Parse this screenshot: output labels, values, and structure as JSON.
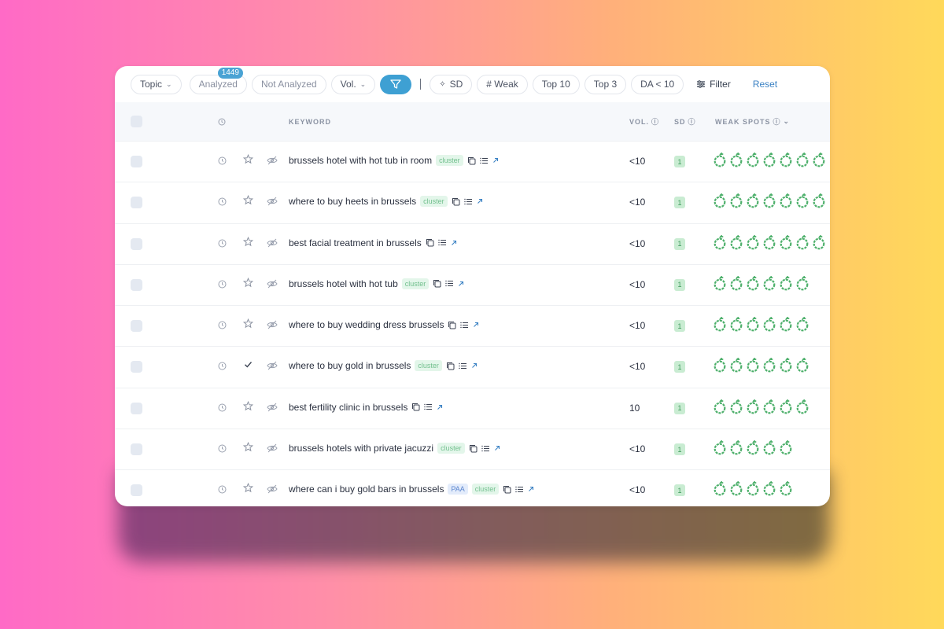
{
  "toolbar": {
    "topic": "Topic",
    "analyzed": "Analyzed",
    "analyzed_count": "1449",
    "not_analyzed": "Not Analyzed",
    "vol": "Vol.",
    "sd": "SD",
    "weak": "# Weak",
    "top10": "Top 10",
    "top3": "Top 3",
    "da": "DA  < 10",
    "filter": "Filter",
    "reset": "Reset"
  },
  "header": {
    "keyword": "KEYWORD",
    "vol": "VOL.",
    "sd": "SD",
    "weak_spots": "WEAK SPOTS"
  },
  "rows": [
    {
      "keyword": "brussels hotel with hot tub in room",
      "tags": [
        "cluster"
      ],
      "vol": "<10",
      "sd": "1",
      "weak": 7,
      "starred": false
    },
    {
      "keyword": "where to buy heets in brussels",
      "tags": [
        "cluster"
      ],
      "vol": "<10",
      "sd": "1",
      "weak": 7,
      "starred": false
    },
    {
      "keyword": "best facial treatment in brussels",
      "tags": [],
      "vol": "<10",
      "sd": "1",
      "weak": 7,
      "starred": false
    },
    {
      "keyword": "brussels hotel with hot tub",
      "tags": [
        "cluster"
      ],
      "vol": "<10",
      "sd": "1",
      "weak": 6,
      "starred": false
    },
    {
      "keyword": "where to buy wedding dress brussels",
      "tags": [],
      "vol": "<10",
      "sd": "1",
      "weak": 6,
      "starred": false
    },
    {
      "keyword": "where to buy gold in brussels",
      "tags": [
        "cluster"
      ],
      "vol": "<10",
      "sd": "1",
      "weak": 6,
      "starred": true
    },
    {
      "keyword": "best fertility clinic in brussels",
      "tags": [],
      "vol": "10",
      "sd": "1",
      "weak": 6,
      "starred": false
    },
    {
      "keyword": "brussels hotels with private jacuzzi",
      "tags": [
        "cluster"
      ],
      "vol": "<10",
      "sd": "1",
      "weak": 5,
      "starred": false
    },
    {
      "keyword": "where can i buy gold bars in brussels",
      "tags": [
        "PAA",
        "cluster"
      ],
      "vol": "<10",
      "sd": "1",
      "weak": 5,
      "starred": false
    }
  ],
  "colors": {
    "accent": "#3ea0d3",
    "weak_spot": "#4caf6a",
    "cluster_tag_bg": "#e3f6ea",
    "paa_tag_bg": "#e3ecfb"
  }
}
